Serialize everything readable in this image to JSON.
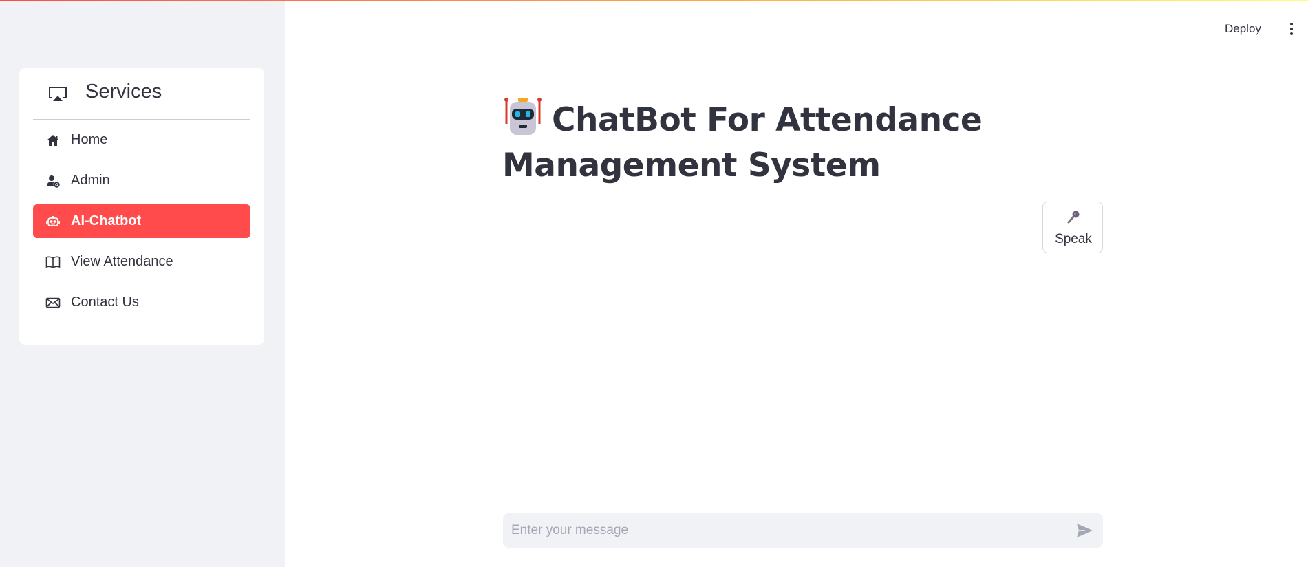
{
  "sidebar": {
    "menu_title": "Services",
    "menu_icon": "airplay-icon",
    "items": [
      {
        "label": "Home",
        "icon": "house-icon",
        "active": false
      },
      {
        "label": "Admin",
        "icon": "person-gear-icon",
        "active": false
      },
      {
        "label": "AI-Chatbot",
        "icon": "robot-icon",
        "active": true
      },
      {
        "label": "View Attendance",
        "icon": "book-icon",
        "active": false
      },
      {
        "label": "Contact Us",
        "icon": "envelope-icon",
        "active": false
      }
    ]
  },
  "header": {
    "deploy_label": "Deploy",
    "menu_icon": "kebab-menu-icon"
  },
  "main": {
    "title_emoji": "robot-emoji-icon",
    "title": "ChatBot For Attendance Management System",
    "speak_button": {
      "icon": "microphone-icon",
      "label": "Speak"
    },
    "chat_input": {
      "placeholder": "Enter your message",
      "value": ""
    },
    "send_icon": "send-icon"
  },
  "colors": {
    "accent": "#ff4b4b",
    "sidebar_bg": "#f0f2f6",
    "text": "#31333f",
    "placeholder": "#a3a8b4"
  }
}
